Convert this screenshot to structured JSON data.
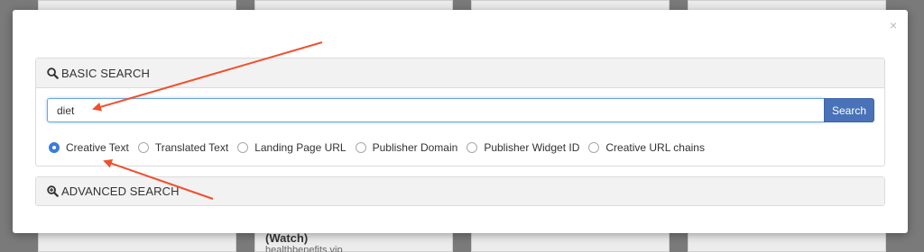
{
  "background": {
    "card_title": "(Watch)",
    "card_sub": "healthbenefits.vip"
  },
  "modal": {
    "close_label": "×",
    "basic_search": {
      "title": "BASIC SEARCH",
      "icon": "search-icon",
      "input_value": "diet",
      "button_label": "Search",
      "options": [
        {
          "label": "Creative Text",
          "checked": true
        },
        {
          "label": "Translated Text",
          "checked": false
        },
        {
          "label": "Landing Page URL",
          "checked": false
        },
        {
          "label": "Publisher Domain",
          "checked": false
        },
        {
          "label": "Publisher Widget ID",
          "checked": false
        },
        {
          "label": "Creative URL chains",
          "checked": false
        }
      ]
    },
    "advanced_search": {
      "title": "ADVANCED SEARCH",
      "icon": "zoom-in-icon"
    }
  },
  "colors": {
    "accent": "#4a72b8",
    "radio_checked": "#3a7be0",
    "annotation_arrow": "#f0502d"
  }
}
